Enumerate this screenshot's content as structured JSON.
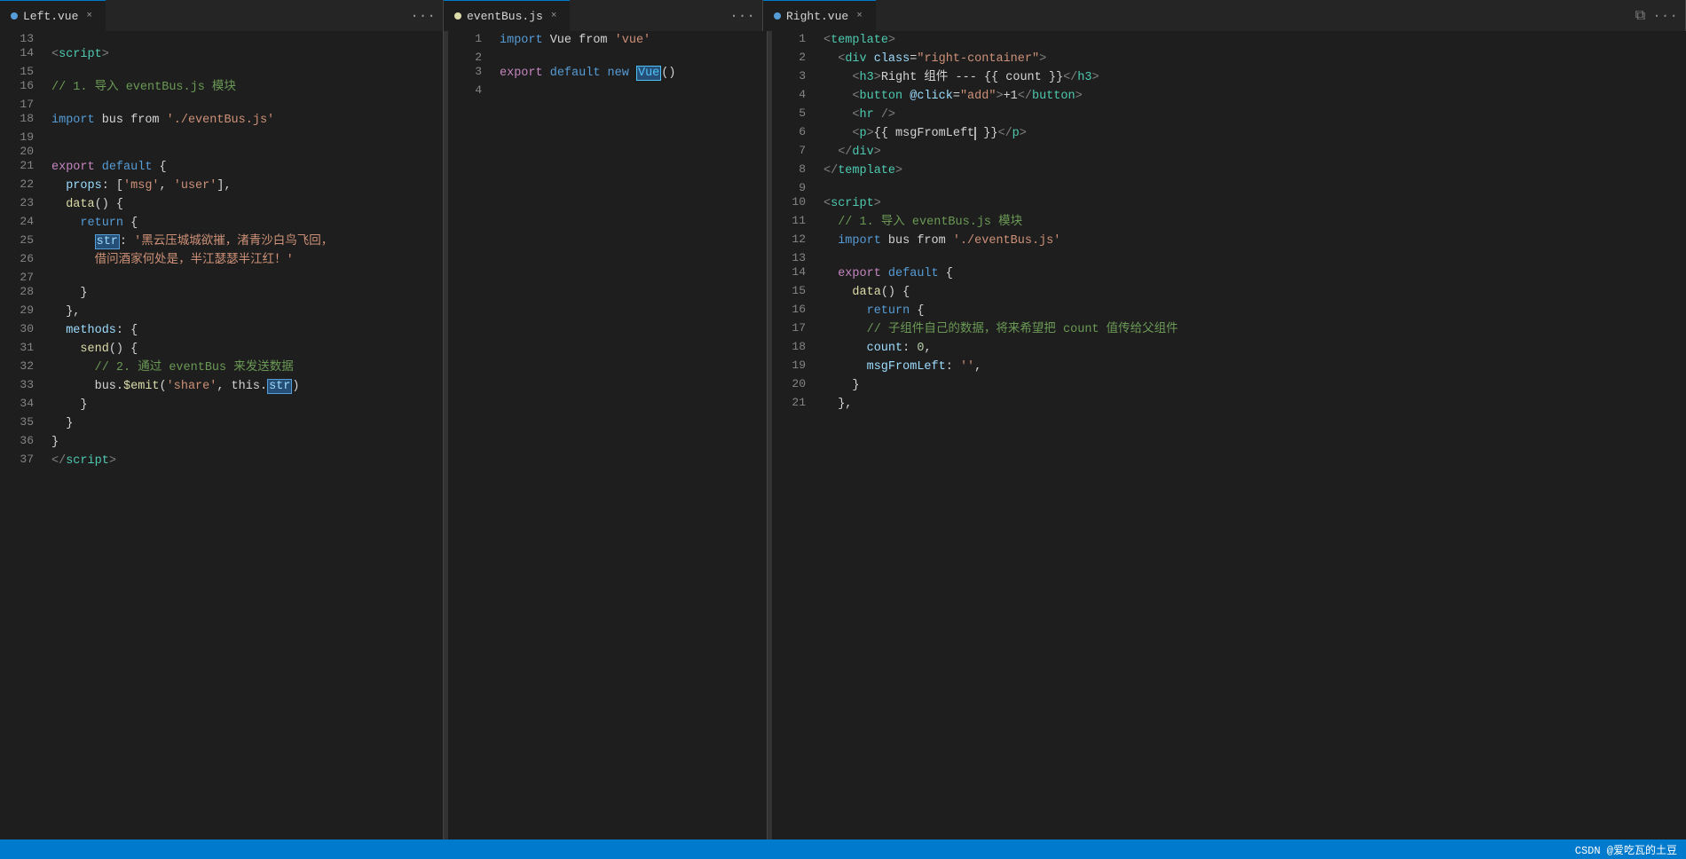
{
  "tabs": {
    "left": {
      "label": "Left.vue",
      "active": true,
      "dot_color": "#569cd6"
    },
    "middle": {
      "label": "eventBus.js",
      "active": true
    },
    "right": {
      "label": "Right.vue",
      "active": true
    }
  },
  "left_code": [
    {
      "num": 13,
      "tokens": []
    },
    {
      "num": 14,
      "tokens": [
        {
          "t": "tag",
          "v": "<"
        },
        {
          "t": "tag-name",
          "v": "script"
        },
        {
          "t": "tag",
          "v": ">"
        }
      ]
    },
    {
      "num": 15,
      "tokens": []
    },
    {
      "num": 16,
      "tokens": [
        {
          "t": "cmt",
          "v": "// 1. 导入 eventBus.js 模块"
        }
      ]
    },
    {
      "num": 17,
      "tokens": []
    },
    {
      "num": 18,
      "tokens": [
        {
          "t": "kw",
          "v": "import"
        },
        {
          "t": "plain",
          "v": " bus "
        },
        {
          "t": "plain",
          "v": "from"
        },
        {
          "t": "plain",
          "v": " "
        },
        {
          "t": "str",
          "v": "'./eventBus.js'"
        }
      ]
    },
    {
      "num": 19,
      "tokens": []
    },
    {
      "num": 20,
      "tokens": []
    },
    {
      "num": 21,
      "tokens": [
        {
          "t": "kw2",
          "v": "export"
        },
        {
          "t": "plain",
          "v": " "
        },
        {
          "t": "kw",
          "v": "default"
        },
        {
          "t": "plain",
          "v": " {"
        }
      ]
    },
    {
      "num": 22,
      "tokens": [
        {
          "t": "plain",
          "v": "  "
        },
        {
          "t": "prop",
          "v": "props"
        },
        {
          "t": "plain",
          "v": ": ["
        },
        {
          "t": "str",
          "v": "'msg'"
        },
        {
          "t": "plain",
          "v": ", "
        },
        {
          "t": "str",
          "v": "'user'"
        },
        {
          "t": "plain",
          "v": "],"
        }
      ]
    },
    {
      "num": 23,
      "tokens": [
        {
          "t": "plain",
          "v": "  "
        },
        {
          "t": "fn",
          "v": "data"
        },
        {
          "t": "plain",
          "v": "() {"
        }
      ]
    },
    {
      "num": 24,
      "tokens": [
        {
          "t": "plain",
          "v": "    "
        },
        {
          "t": "kw",
          "v": "return"
        },
        {
          "t": "plain",
          "v": " {"
        }
      ]
    },
    {
      "num": 25,
      "tokens": [
        {
          "t": "plain",
          "v": "      "
        },
        {
          "t": "highlight",
          "v": "str"
        },
        {
          "t": "plain",
          "v": ": "
        },
        {
          "t": "str",
          "v": "'黑云压城城欲摧，渚青沙白鸟飞回，"
        }
      ]
    },
    {
      "num": 26,
      "tokens": [
        {
          "t": "plain",
          "v": "      "
        },
        {
          "t": "str",
          "v": "借问酒家何处是，半江瑟瑟半江红！'"
        }
      ]
    },
    {
      "num": 27,
      "tokens": []
    },
    {
      "num": 28,
      "tokens": [
        {
          "t": "plain",
          "v": "    }"
        }
      ]
    },
    {
      "num": 29,
      "tokens": [
        {
          "t": "plain",
          "v": "  "
        },
        {
          "t": "plain",
          "v": "},"
        }
      ]
    },
    {
      "num": 30,
      "tokens": [
        {
          "t": "plain",
          "v": "  "
        },
        {
          "t": "prop",
          "v": "methods"
        },
        {
          "t": "plain",
          "v": ": {"
        }
      ]
    },
    {
      "num": 31,
      "tokens": [
        {
          "t": "plain",
          "v": "    "
        },
        {
          "t": "fn",
          "v": "send"
        },
        {
          "t": "plain",
          "v": "() {"
        }
      ]
    },
    {
      "num": 32,
      "tokens": [
        {
          "t": "plain",
          "v": "      "
        },
        {
          "t": "cmt",
          "v": "// 2. 通过 eventBus 来发送数据"
        }
      ]
    },
    {
      "num": 33,
      "tokens": [
        {
          "t": "plain",
          "v": "      bus."
        },
        {
          "t": "fn",
          "v": "$emit"
        },
        {
          "t": "plain",
          "v": "("
        },
        {
          "t": "str",
          "v": "'share'"
        },
        {
          "t": "plain",
          "v": ", this."
        },
        {
          "t": "highlight",
          "v": "str"
        },
        {
          "t": "plain",
          "v": ")"
        }
      ]
    },
    {
      "num": 34,
      "tokens": [
        {
          "t": "plain",
          "v": "    }"
        }
      ]
    },
    {
      "num": 35,
      "tokens": [
        {
          "t": "plain",
          "v": "  }"
        }
      ]
    },
    {
      "num": 36,
      "tokens": [
        {
          "t": "plain",
          "v": "}"
        }
      ]
    },
    {
      "num": 37,
      "tokens": [
        {
          "t": "tag",
          "v": "</"
        },
        {
          "t": "tag-name",
          "v": "script"
        },
        {
          "t": "tag",
          "v": ">"
        }
      ]
    }
  ],
  "middle_code": [
    {
      "num": 1,
      "tokens": [
        {
          "t": "kw",
          "v": "import"
        },
        {
          "t": "plain",
          "v": " Vue "
        },
        {
          "t": "plain",
          "v": "from"
        },
        {
          "t": "plain",
          "v": " "
        },
        {
          "t": "str",
          "v": "'vue'"
        }
      ]
    },
    {
      "num": 2,
      "tokens": []
    },
    {
      "num": 3,
      "tokens": [
        {
          "t": "kw2",
          "v": "export"
        },
        {
          "t": "plain",
          "v": " "
        },
        {
          "t": "kw",
          "v": "default"
        },
        {
          "t": "plain",
          "v": " "
        },
        {
          "t": "kw",
          "v": "new"
        },
        {
          "t": "plain",
          "v": " "
        },
        {
          "t": "highlight-word",
          "v": "Vue"
        },
        {
          "t": "plain",
          "v": "()"
        }
      ]
    },
    {
      "num": 4,
      "tokens": []
    }
  ],
  "right_code": [
    {
      "num": 1,
      "tokens": [
        {
          "t": "tag",
          "v": "<"
        },
        {
          "t": "tag-name",
          "v": "template"
        },
        {
          "t": "tag",
          "v": ">"
        }
      ]
    },
    {
      "num": 2,
      "tokens": [
        {
          "t": "plain",
          "v": "  "
        },
        {
          "t": "tag",
          "v": "<"
        },
        {
          "t": "tag-name",
          "v": "div"
        },
        {
          "t": "plain",
          "v": " "
        },
        {
          "t": "attr-name",
          "v": "class"
        },
        {
          "t": "plain",
          "v": "="
        },
        {
          "t": "attr-val",
          "v": "\"right-container\""
        },
        {
          "t": "tag",
          "v": ">"
        }
      ]
    },
    {
      "num": 3,
      "tokens": [
        {
          "t": "plain",
          "v": "    "
        },
        {
          "t": "tag",
          "v": "<"
        },
        {
          "t": "tag-name",
          "v": "h3"
        },
        {
          "t": "tag",
          "v": ">"
        },
        {
          "t": "plain",
          "v": "Right 组件 --- {{ count }}"
        },
        {
          "t": "tag",
          "v": "</"
        },
        {
          "t": "tag-name",
          "v": "h3"
        },
        {
          "t": "tag",
          "v": ">"
        }
      ]
    },
    {
      "num": 4,
      "tokens": [
        {
          "t": "plain",
          "v": "    "
        },
        {
          "t": "tag",
          "v": "<"
        },
        {
          "t": "tag-name",
          "v": "button"
        },
        {
          "t": "plain",
          "v": " "
        },
        {
          "t": "attr-name",
          "v": "@click"
        },
        {
          "t": "plain",
          "v": "="
        },
        {
          "t": "attr-val",
          "v": "\"add\""
        },
        {
          "t": "tag",
          "v": ">"
        },
        {
          "t": "plain",
          "v": "+1"
        },
        {
          "t": "tag",
          "v": "</"
        },
        {
          "t": "tag-name",
          "v": "button"
        },
        {
          "t": "tag",
          "v": ">"
        }
      ]
    },
    {
      "num": 5,
      "tokens": [
        {
          "t": "plain",
          "v": "    "
        },
        {
          "t": "tag",
          "v": "<"
        },
        {
          "t": "tag-name",
          "v": "hr"
        },
        {
          "t": "plain",
          "v": " "
        },
        {
          "t": "tag",
          "v": "/>"
        }
      ]
    },
    {
      "num": 6,
      "tokens": [
        {
          "t": "plain",
          "v": "    "
        },
        {
          "t": "tag",
          "v": "<"
        },
        {
          "t": "tag-name",
          "v": "p"
        },
        {
          "t": "tag",
          "v": ">"
        },
        {
          "t": "plain",
          "v": "{{ msgFromLeft"
        },
        {
          "t": "cursor",
          "v": ""
        },
        {
          "t": "plain",
          "v": " }}"
        },
        {
          "t": "tag",
          "v": "</"
        },
        {
          "t": "tag-name",
          "v": "p"
        },
        {
          "t": "tag",
          "v": ">"
        }
      ]
    },
    {
      "num": 7,
      "tokens": [
        {
          "t": "plain",
          "v": "  "
        },
        {
          "t": "tag",
          "v": "</"
        },
        {
          "t": "tag-name",
          "v": "div"
        },
        {
          "t": "tag",
          "v": ">"
        }
      ]
    },
    {
      "num": 8,
      "tokens": [
        {
          "t": "tag",
          "v": "</"
        },
        {
          "t": "tag-name",
          "v": "template"
        },
        {
          "t": "tag",
          "v": ">"
        }
      ]
    },
    {
      "num": 9,
      "tokens": []
    },
    {
      "num": 10,
      "tokens": [
        {
          "t": "tag",
          "v": "<"
        },
        {
          "t": "tag-name",
          "v": "script"
        },
        {
          "t": "tag",
          "v": ">"
        }
      ]
    },
    {
      "num": 11,
      "tokens": [
        {
          "t": "cmt",
          "v": "  // 1. 导入 eventBus.js 模块"
        }
      ]
    },
    {
      "num": 12,
      "tokens": [
        {
          "t": "plain",
          "v": "  "
        },
        {
          "t": "kw",
          "v": "import"
        },
        {
          "t": "plain",
          "v": " bus "
        },
        {
          "t": "plain",
          "v": "from"
        },
        {
          "t": "plain",
          "v": " "
        },
        {
          "t": "str",
          "v": "'./eventBus.js'"
        }
      ]
    },
    {
      "num": 13,
      "tokens": []
    },
    {
      "num": 14,
      "tokens": [
        {
          "t": "kw2",
          "v": "  export"
        },
        {
          "t": "plain",
          "v": " "
        },
        {
          "t": "kw",
          "v": "default"
        },
        {
          "t": "plain",
          "v": " {"
        }
      ]
    },
    {
      "num": 15,
      "tokens": [
        {
          "t": "plain",
          "v": "  "
        },
        {
          "t": "fn",
          "v": "  data"
        },
        {
          "t": "plain",
          "v": "() {"
        }
      ]
    },
    {
      "num": 16,
      "tokens": [
        {
          "t": "plain",
          "v": "    "
        },
        {
          "t": "kw",
          "v": "  return"
        },
        {
          "t": "plain",
          "v": " {"
        }
      ]
    },
    {
      "num": 17,
      "tokens": [
        {
          "t": "cmt",
          "v": "      // 子组件自己的数据，将来希望把 count 值传给父组件"
        }
      ]
    },
    {
      "num": 18,
      "tokens": [
        {
          "t": "plain",
          "v": "      "
        },
        {
          "t": "prop",
          "v": "count"
        },
        {
          "t": "plain",
          "v": ": "
        },
        {
          "t": "num",
          "v": "0"
        },
        {
          "t": "plain",
          "v": ","
        }
      ]
    },
    {
      "num": 19,
      "tokens": [
        {
          "t": "plain",
          "v": "      "
        },
        {
          "t": "prop",
          "v": "msgFromLeft"
        },
        {
          "t": "plain",
          "v": ": "
        },
        {
          "t": "str",
          "v": "''"
        },
        {
          "t": "plain",
          "v": ","
        }
      ]
    },
    {
      "num": 20,
      "tokens": [
        {
          "t": "plain",
          "v": "    }"
        }
      ]
    },
    {
      "num": 21,
      "tokens": [
        {
          "t": "plain",
          "v": "  "
        },
        {
          "t": "plain",
          "v": "},"
        }
      ]
    }
  ],
  "status_bar": {
    "text": "CSDN @爱吃瓦的土豆"
  }
}
